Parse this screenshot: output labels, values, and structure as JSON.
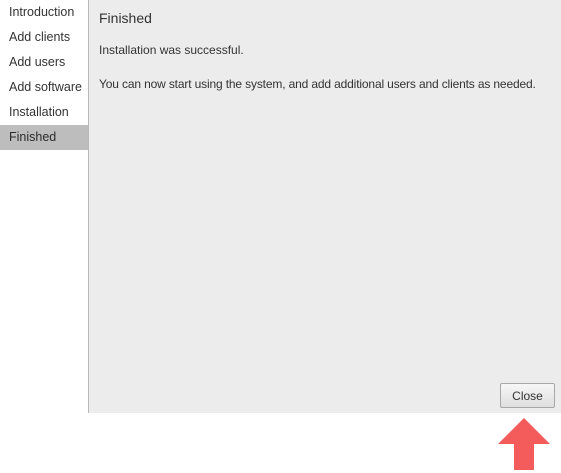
{
  "sidebar": {
    "items": [
      {
        "label": "Introduction"
      },
      {
        "label": "Add clients"
      },
      {
        "label": "Add users"
      },
      {
        "label": "Add software"
      },
      {
        "label": "Installation"
      },
      {
        "label": "Finished"
      }
    ],
    "active_index": 5
  },
  "main": {
    "title": "Finished",
    "message": "Installation was successful.",
    "detail": "You can now start using the system, and add additional users and clients as needed.",
    "close_label": "Close"
  },
  "annotation": {
    "arrow_color": "#f45b5b",
    "icon": "up-arrow-icon"
  }
}
